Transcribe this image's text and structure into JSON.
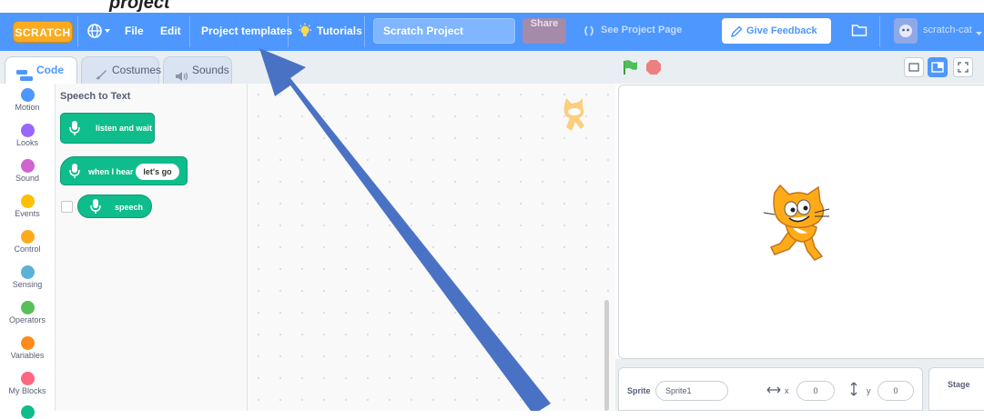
{
  "menu": {
    "logo": "SCRATCH",
    "file": "File",
    "edit": "Edit",
    "project_templates": "Project templates",
    "tutorials": "Tutorials",
    "project_title": "Scratch Project",
    "share": "Share",
    "see_project_page": "See Project Page",
    "give_feedback": "Give Feedback",
    "username": "scratch-cat"
  },
  "tabs": [
    {
      "label": "Code"
    },
    {
      "label": "Costumes"
    },
    {
      "label": "Sounds"
    }
  ],
  "categories": [
    {
      "label": "Motion",
      "color": "#4c97ff"
    },
    {
      "label": "Looks",
      "color": "#9966ff"
    },
    {
      "label": "Sound",
      "color": "#cf63cf"
    },
    {
      "label": "Events",
      "color": "#ffbf00"
    },
    {
      "label": "Control",
      "color": "#ffab19"
    },
    {
      "label": "Sensing",
      "color": "#5cb1d6"
    },
    {
      "label": "Operators",
      "color": "#59c059"
    },
    {
      "label": "Variables",
      "color": "#ff8c1a"
    },
    {
      "label": "My Blocks",
      "color": "#ff6680"
    }
  ],
  "flyout": {
    "heading": "Speech to Text",
    "blocks": {
      "listen": "listen and wait",
      "when_hear": "when I hear",
      "when_hear_arg": "let's go",
      "speech": "speech"
    }
  },
  "sprite_info": {
    "sprite_label": "Sprite",
    "sprite_name": "Sprite1",
    "x_label": "x",
    "x_value": "0",
    "y_label": "y",
    "y_value": "0"
  },
  "stage_panel": {
    "label": "Stage"
  },
  "colors": {
    "menu": "#4d97ff",
    "extension_block": "#0fbd8c",
    "arrow": "#4a72c4"
  },
  "partial_caption_text": "project"
}
